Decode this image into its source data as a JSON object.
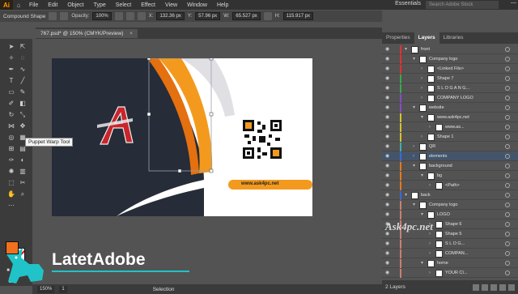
{
  "menubar": {
    "app_logo": "Ai",
    "items": [
      "File",
      "Edit",
      "Object",
      "Type",
      "Select",
      "Effect",
      "View",
      "Window",
      "Help"
    ],
    "workspace": "Essentials",
    "search_placeholder": "Search Adobe Stock",
    "window_controls": "—"
  },
  "controlbar": {
    "object_type": "Compound Shape",
    "opacity_label": "Opacity:",
    "opacity_value": "100%",
    "x_label": "X:",
    "x_value": "132.36 px",
    "y_label": "Y:",
    "y_value": "57.96 px",
    "w_label": "W:",
    "w_value": "65.527 px",
    "h_label": "H:",
    "h_value": "115.917 px"
  },
  "document": {
    "tab_title": "767.psd* @ 150% (CMYK/Preview)",
    "close": "×"
  },
  "toolbar": {
    "tooltip": "Puppet Warp Tool",
    "fill_color": "#f07020"
  },
  "artboard": {
    "website_text": "www.ask4pc.net",
    "colors": {
      "navy": "#262c38",
      "orange": "#f39a1e",
      "dark_orange": "#e4700f",
      "grey": "#e2e2e6",
      "logo_red": "#c8262b"
    }
  },
  "statusbar": {
    "zoom": "150%",
    "artboard_num": "1",
    "mode": "Selection"
  },
  "panel": {
    "tabs": [
      "Properties",
      "Layers",
      "Libraries"
    ],
    "active_tab": "Layers",
    "layers_count": "2 Layers",
    "layers": [
      {
        "name": "front",
        "indent": 0,
        "color": "#e53030",
        "expanded": true,
        "thumb": true
      },
      {
        "name": "Company logo",
        "indent": 1,
        "color": "#e53030",
        "expanded": true,
        "thumb": true
      },
      {
        "name": "<Linked File>",
        "indent": 2,
        "color": "#e53030",
        "expanded": false,
        "thumb": true
      },
      {
        "name": "Shape 7",
        "indent": 2,
        "color": "#3aa84a",
        "expanded": false,
        "thumb": true
      },
      {
        "name": "S L O G A N G...",
        "indent": 2,
        "color": "#3aa84a",
        "expanded": false,
        "thumb": true
      },
      {
        "name": "COMPANY LOGO",
        "indent": 2,
        "color": "#8a4ac8",
        "expanded": false,
        "thumb": true
      },
      {
        "name": "website",
        "indent": 1,
        "color": "#8a4ac8",
        "expanded": true,
        "thumb": true
      },
      {
        "name": "www.ask4pc.net",
        "indent": 2,
        "color": "#d8c030",
        "expanded": true,
        "thumb": true
      },
      {
        "name": "www.as...",
        "indent": 3,
        "color": "#d8c030",
        "expanded": false,
        "thumb": true
      },
      {
        "name": "Shape 1",
        "indent": 2,
        "color": "#d8c030",
        "expanded": false,
        "thumb": true
      },
      {
        "name": "QR",
        "indent": 1,
        "color": "#3ab0b0",
        "expanded": false,
        "thumb": true
      },
      {
        "name": "elements",
        "indent": 1,
        "color": "#3a6ad8",
        "expanded": false,
        "thumb": true,
        "selected": true
      },
      {
        "name": "background",
        "indent": 1,
        "color": "#e07a20",
        "expanded": true,
        "thumb": true
      },
      {
        "name": "bg",
        "indent": 2,
        "color": "#e07a20",
        "expanded": true,
        "thumb": true
      },
      {
        "name": "<Path>",
        "indent": 3,
        "color": "#e07a20",
        "expanded": false,
        "thumb": true
      },
      {
        "name": "back",
        "indent": 0,
        "color": "#3a6ad8",
        "expanded": true,
        "thumb": true
      },
      {
        "name": "Company logo",
        "indent": 1,
        "color": "#c88070",
        "expanded": true,
        "thumb": true
      },
      {
        "name": "LOGO",
        "indent": 2,
        "color": "#c88070",
        "expanded": true,
        "thumb": true
      },
      {
        "name": "Shape 6",
        "indent": 3,
        "color": "#c88070",
        "expanded": false,
        "thumb": true
      },
      {
        "name": "Shape 5",
        "indent": 3,
        "color": "#c88070",
        "expanded": false,
        "thumb": true
      },
      {
        "name": "S L O G...",
        "indent": 3,
        "color": "#c88070",
        "expanded": false,
        "thumb": true
      },
      {
        "name": "COMPAN...",
        "indent": 3,
        "color": "#c88070",
        "expanded": false,
        "thumb": true
      },
      {
        "name": "home",
        "indent": 2,
        "color": "#c88070",
        "expanded": true,
        "thumb": true
      },
      {
        "name": "YOUR CI...",
        "indent": 3,
        "color": "#c88070",
        "expanded": false,
        "thumb": true
      }
    ]
  },
  "watermarks": {
    "latet": "LatetAdobe",
    "ask4pc": "Ask4pc.net"
  }
}
